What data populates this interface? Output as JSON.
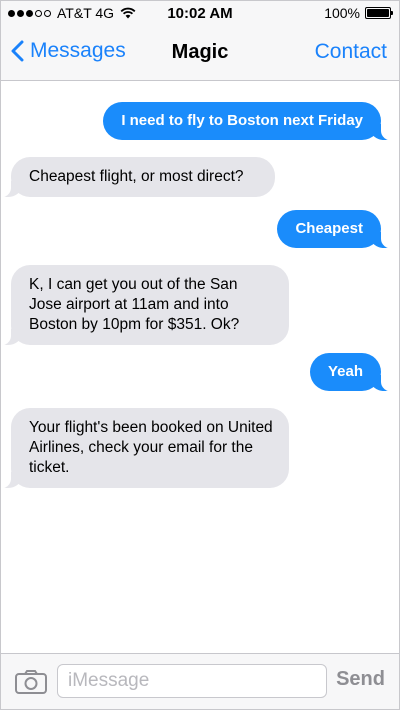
{
  "status_bar": {
    "signal_filled": 3,
    "signal_total": 5,
    "carrier": "AT&T 4G",
    "wifi_icon": "wifi-icon",
    "time": "10:02 AM",
    "battery_percent": "100%",
    "battery_level": 1.0
  },
  "nav": {
    "back_label": "Messages",
    "back_icon": "chevron-left-icon",
    "title": "Magic",
    "contact_label": "Contact"
  },
  "messages": [
    {
      "direction": "outgoing",
      "text": "I need to fly to Boston next Friday"
    },
    {
      "direction": "incoming",
      "text": "Cheapest flight, or most direct?"
    },
    {
      "direction": "outgoing",
      "text": "Cheapest"
    },
    {
      "direction": "incoming",
      "text": "K, I can get you out of the San Jose airport at 11am and into Boston by 10pm for $351. Ok?"
    },
    {
      "direction": "outgoing",
      "text": "Yeah"
    },
    {
      "direction": "incoming",
      "text": "Your flight's been booked on United Airlines, check your email for the ticket."
    }
  ],
  "input": {
    "camera_icon": "camera-icon",
    "placeholder": "iMessage",
    "value": "",
    "send_label": "Send"
  },
  "colors": {
    "accent": "#1a82fb",
    "outgoing_bubble": "#1a8cfb",
    "incoming_bubble": "#e5e5ea",
    "bar_background": "#f7f7f8"
  }
}
